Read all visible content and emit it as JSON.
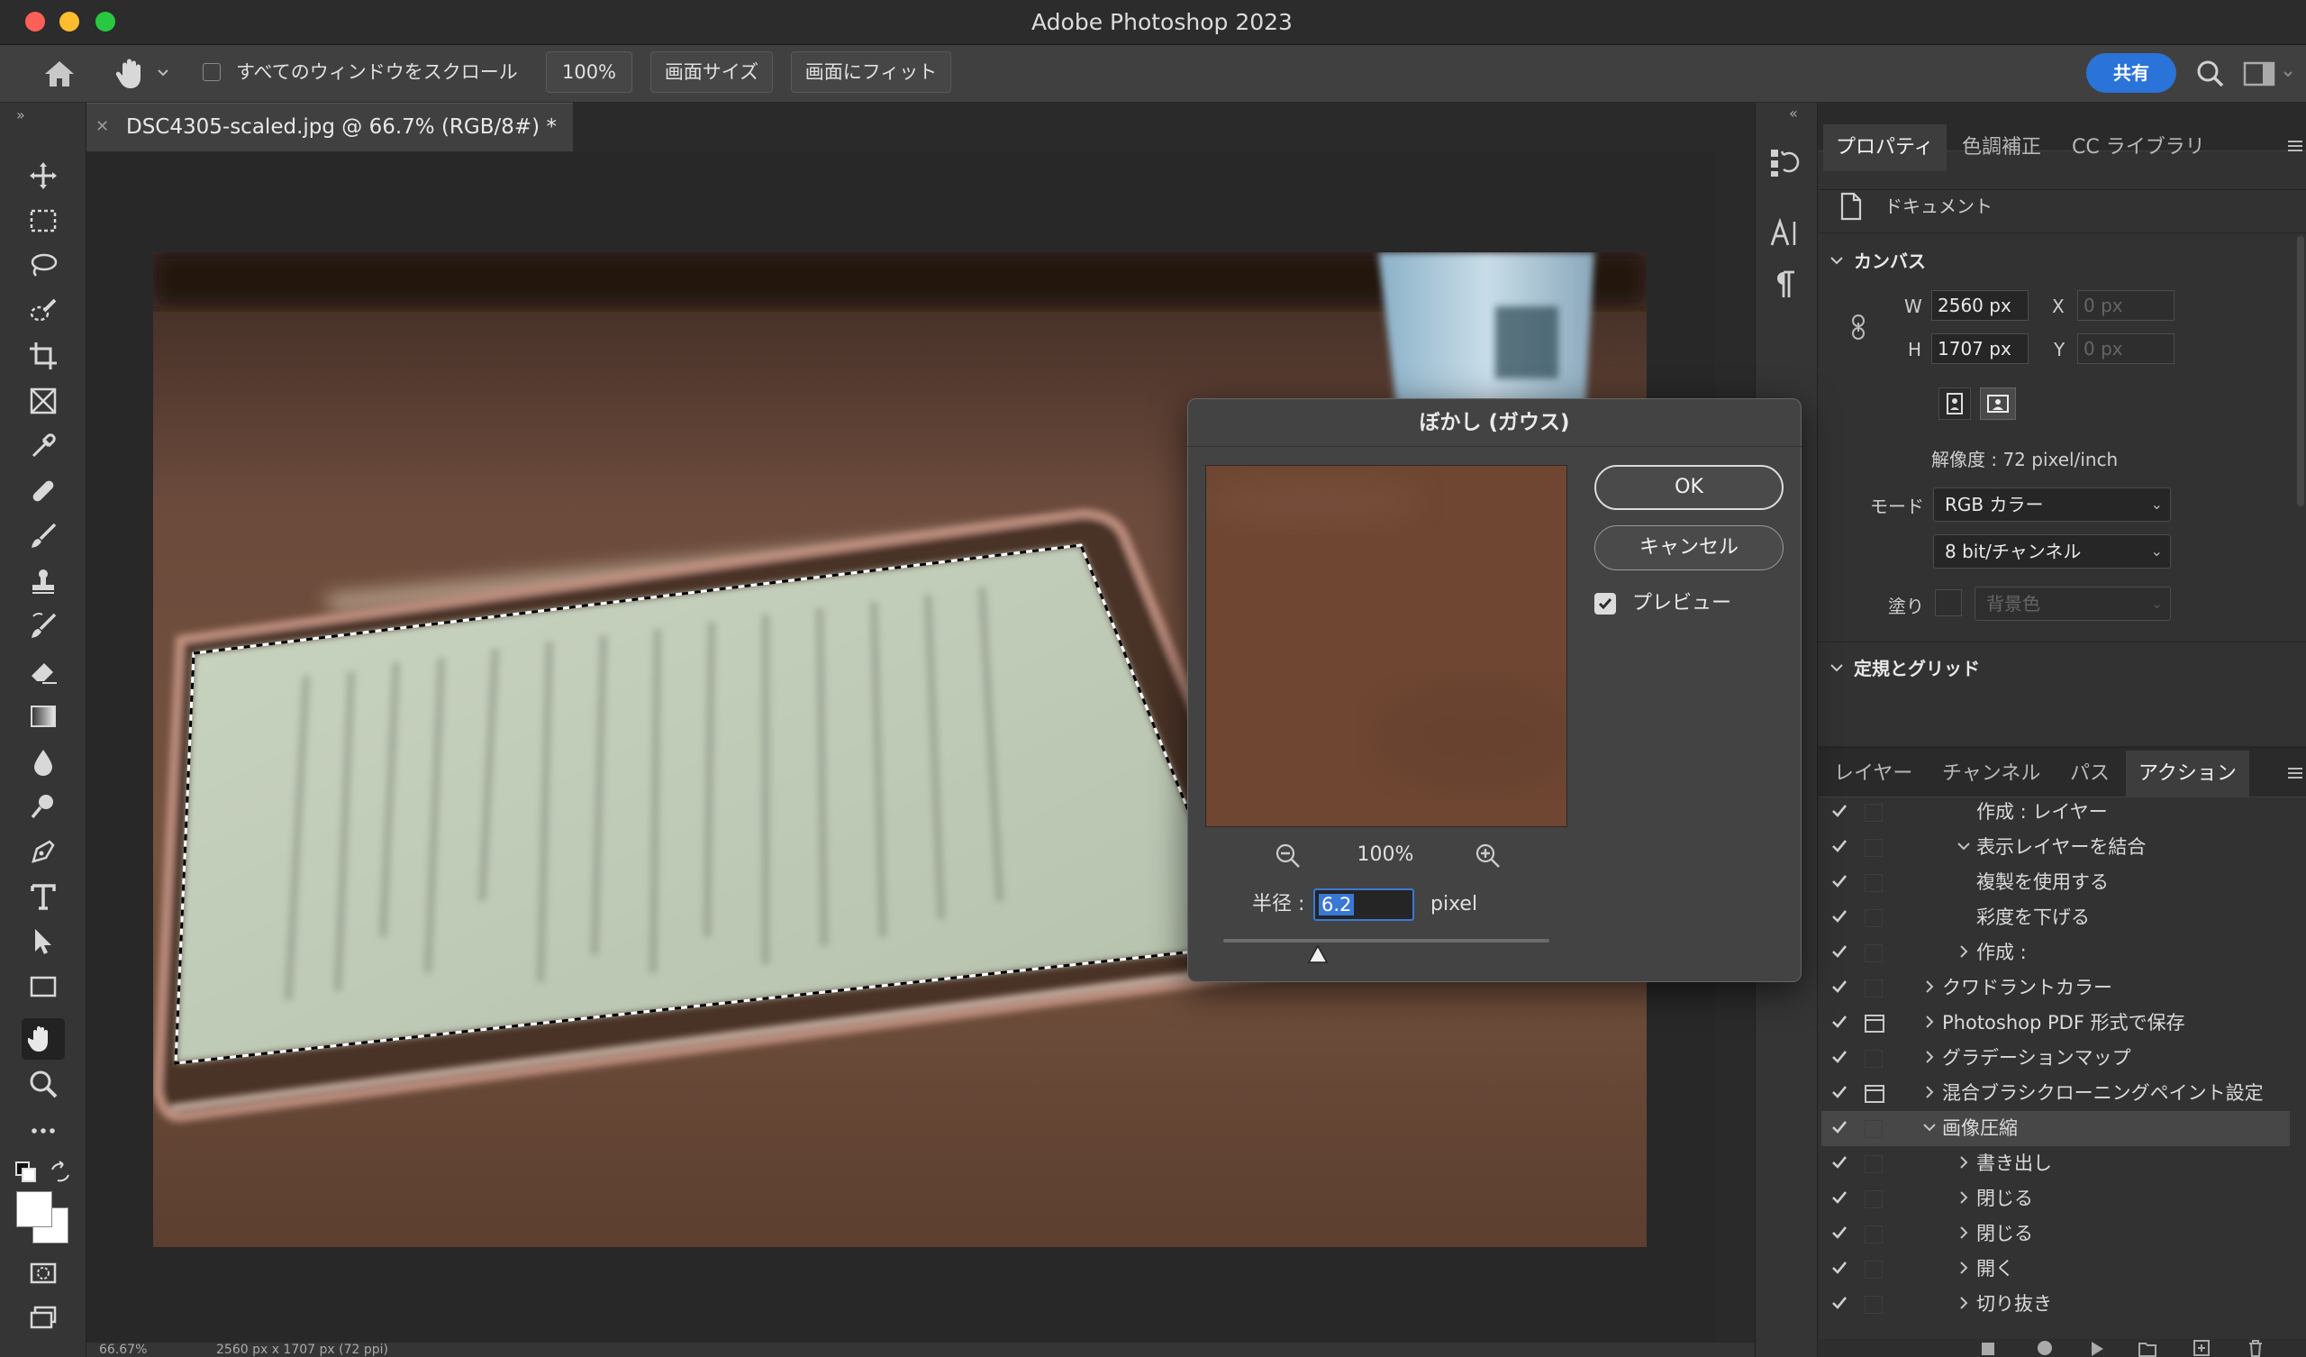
{
  "app": {
    "title": "Adobe Photoshop 2023"
  },
  "options_bar": {
    "scroll_all_label": "すべてのウィンドウをスクロール",
    "zoom_value": "100%",
    "screen_size_label": "画面サイズ",
    "fit_screen_label": "画面にフィット",
    "share_label": "共有"
  },
  "document": {
    "tab_title": "DSC4305-scaled.jpg @ 66.7% (RGB/8#) *",
    "status_zoom": "66.67%",
    "status_dims": "2560 px x 1707 px (72 ppi)"
  },
  "properties_panel": {
    "tabs": [
      "プロパティ",
      "色調補正",
      "CC ライブラリ"
    ],
    "doc_label": "ドキュメント",
    "canvas_section": "カンバス",
    "w_label": "W",
    "w_value": "2560 px",
    "h_label": "H",
    "h_value": "1707 px",
    "x_label": "X",
    "x_value": "0 px",
    "y_label": "Y",
    "y_value": "0 px",
    "resolution": "解像度 : 72 pixel/inch",
    "mode_label": "モード",
    "mode_value": "RGB カラー",
    "bit_value": "8 bit/チャンネル",
    "fill_label": "塗り",
    "fill_value": "背景色",
    "rulers_section": "定規とグリッド"
  },
  "actions_panel": {
    "tabs": [
      "レイヤー",
      "チャンネル",
      "パス",
      "アクション"
    ],
    "rows": [
      {
        "label": "作成 : レイヤー",
        "indent": 2,
        "expand": "",
        "dialog": false,
        "selected": false
      },
      {
        "label": "表示レイヤーを結合",
        "indent": 2,
        "expand": "v",
        "dialog": false,
        "selected": false
      },
      {
        "label": "複製を使用する",
        "indent": 2,
        "expand": "",
        "dialog": false,
        "selected": false
      },
      {
        "label": "彩度を下げる",
        "indent": 2,
        "expand": "",
        "dialog": false,
        "selected": false
      },
      {
        "label": "作成 :",
        "indent": 2,
        "expand": ">",
        "dialog": false,
        "selected": false
      },
      {
        "label": "クワドラントカラー",
        "indent": 1,
        "expand": ">",
        "dialog": false,
        "selected": false
      },
      {
        "label": "Photoshop PDF 形式で保存",
        "indent": 1,
        "expand": ">",
        "dialog": true,
        "selected": false
      },
      {
        "label": "グラデーションマップ",
        "indent": 1,
        "expand": ">",
        "dialog": false,
        "selected": false
      },
      {
        "label": "混合ブラシクローニングペイント設定",
        "indent": 1,
        "expand": ">",
        "dialog": true,
        "selected": false
      },
      {
        "label": "画像圧縮",
        "indent": 1,
        "expand": "v",
        "dialog": false,
        "selected": true
      },
      {
        "label": "書き出し",
        "indent": 2,
        "expand": ">",
        "dialog": false,
        "selected": false
      },
      {
        "label": "閉じる",
        "indent": 2,
        "expand": ">",
        "dialog": false,
        "selected": false
      },
      {
        "label": "閉じる",
        "indent": 2,
        "expand": ">",
        "dialog": false,
        "selected": false
      },
      {
        "label": "開く",
        "indent": 2,
        "expand": ">",
        "dialog": false,
        "selected": false
      },
      {
        "label": "切り抜き",
        "indent": 2,
        "expand": ">",
        "dialog": false,
        "selected": false
      }
    ]
  },
  "blur_dialog": {
    "title": "ぼかし (ガウス)",
    "ok_label": "OK",
    "cancel_label": "キャンセル",
    "preview_label": "プレビュー",
    "preview_checked": true,
    "zoom_value": "100%",
    "radius_label": "半径 :",
    "radius_value": "6.2",
    "radius_unit": "pixel",
    "slider_fraction": 0.29
  },
  "colors": {
    "accent": "#2a73d8",
    "preview_fill": "#6e4632",
    "traffic_close": "#fe5f57",
    "traffic_min": "#febc2e",
    "traffic_max": "#28c840"
  }
}
